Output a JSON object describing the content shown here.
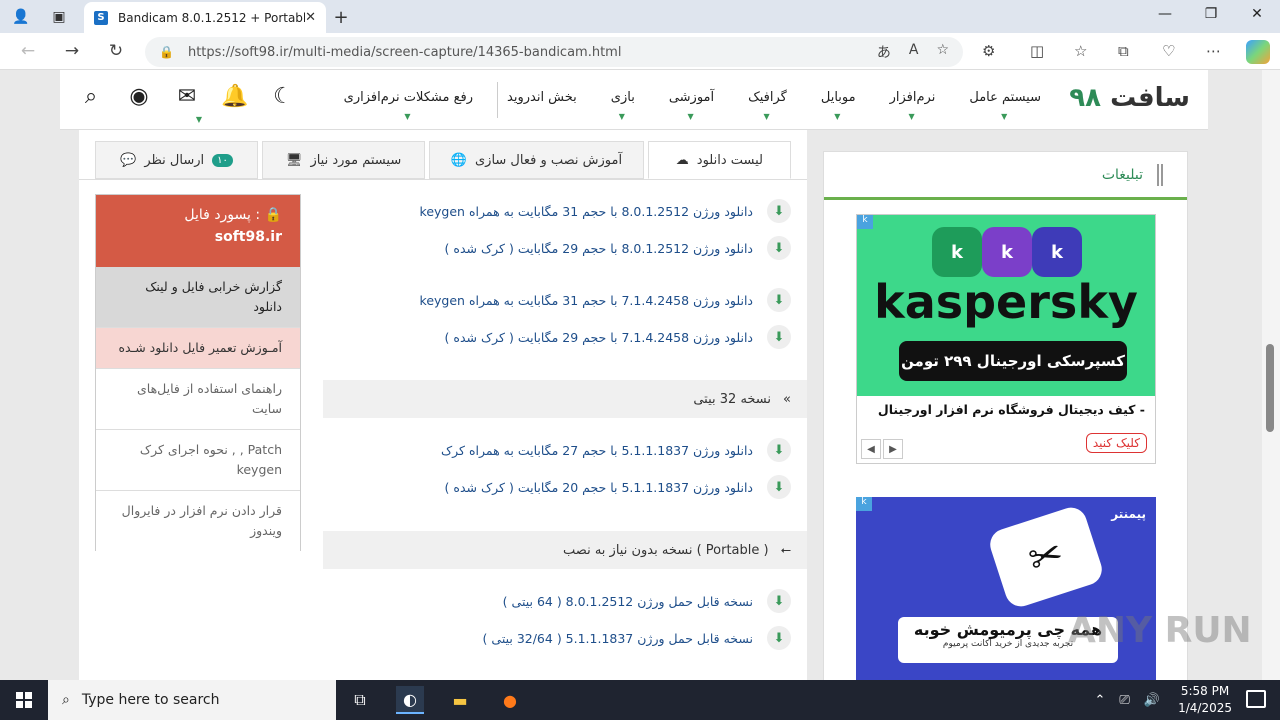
{
  "browser": {
    "tab_title": "Bandicam 8.0.1.2512 + Portable",
    "url": "https://soft98.ir/multi-media/screen-capture/14365-bandicam.html"
  },
  "site": {
    "logo_main": "سافت",
    "logo_num": "۹۸",
    "menu": [
      "سیستم عامل",
      "نرم‌افزار",
      "موبایل",
      "گرافیک",
      "آموزشی",
      "بازی",
      "بخش اندروید",
      "رفع مشکلات نرم‌افزاری"
    ]
  },
  "tabs": {
    "download_list": "لیست دانلود",
    "install_guide": "آموزش نصب و فعال سازی",
    "requirements": "سیستم مورد نیاز",
    "comments": "ارسال نظر",
    "comments_count": "۱۰"
  },
  "sidebox": {
    "password_label": "پسورد فایل :",
    "password_value": "soft98.ir",
    "item1": "گزارش خرابی فایل و لینک دانلود",
    "item2": "آمـوزش تعمیر فایل دانلود شـده",
    "item3": "راهنمای استفاده از فایل‌های سایت",
    "item4": "نحوه اجرای کرک , , Patch keygen",
    "item5": "قرار دادن نرم افزار در فایروال ویندوز"
  },
  "downloads": {
    "r1": "دانلود ورژن 8.0.1.2512 با حجم 31 مگابایت به همراه keygen",
    "r2": "دانلود ورژن 8.0.1.2512 با حجم 29 مگابایت ( کرک شده )",
    "r3": "دانلود ورژن 7.1.4.2458 با حجم 31 مگابایت به همراه keygen",
    "r4": "دانلود ورژن 7.1.4.2458 با حجم 29 مگابایت ( کرک شده )",
    "section32": "نسخه 32 بیتی",
    "r5": "دانلود ورژن 5.1.1.1837 با حجم 27 مگابایت به همراه کرک",
    "r6": "دانلود ورژن 5.1.1.1837 با حجم 20 مگابایت ( کرک شده )",
    "sectionPortable": "نسخه بدون نیاز به نصب ( Portable )",
    "r7": "نسخه قابل حمل ورژن 8.0.1.2512 ( 64 بیتی )",
    "r8": "نسخه قابل حمل ورژن 5.1.1.1837 ( 32/64 بیتی )"
  },
  "aside": {
    "title": "تبلیغات",
    "ad1_brand": "kaspersky",
    "ad1_pill": "کسپرسکی اورجینال ۲۹۹ تومن",
    "ad1_text": "کیف دیجیتال فروشگاه نرم افزار اورجینال -",
    "ad1_button": "کلیک کنید",
    "ad2_logo": "پیمنتر",
    "ad2_cta": "همه چی پرمیومش خوبه",
    "ad2_sub": "تجربه جدیدی از خرید اکانت پرمیوم"
  },
  "watermark": "ANY RUN",
  "taskbar": {
    "search_placeholder": "Type here to search",
    "time": "5:58 PM",
    "date": "1/4/2025"
  },
  "colors": {
    "accent": "#3a9a5a",
    "password_bg": "#d45a45",
    "link": "#1e4e8a"
  }
}
